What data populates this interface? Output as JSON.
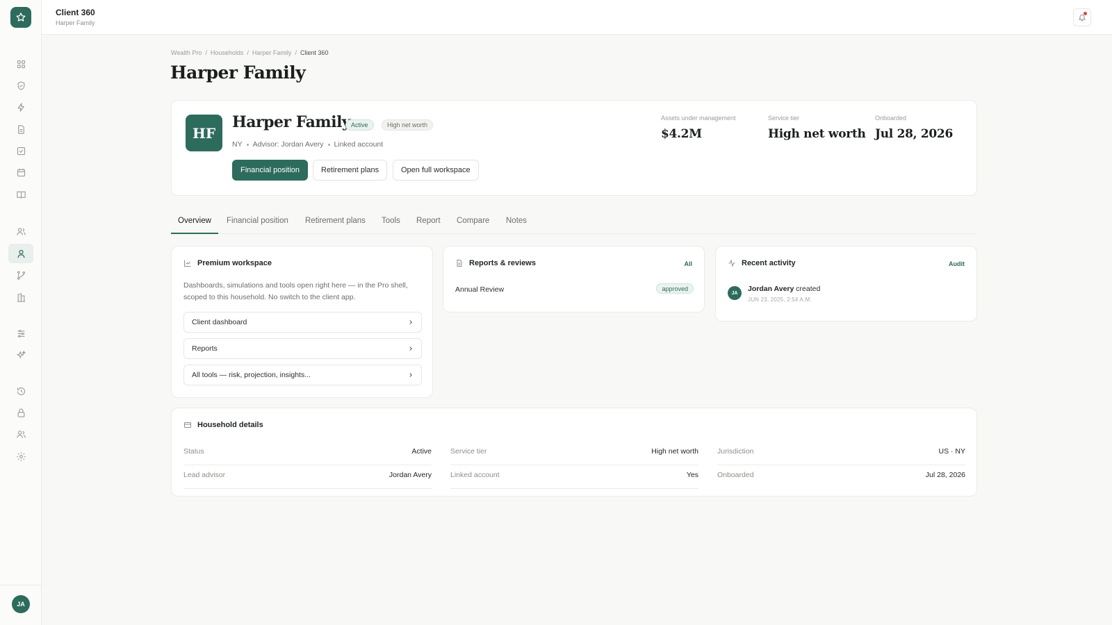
{
  "topbar": {
    "title": "Client 360",
    "subtitle": "Harper Family"
  },
  "breadcrumb": [
    "Wealth Pro",
    "Households",
    "Harper Family",
    "Client 360"
  ],
  "breadcrumb_sep": "/",
  "page": {
    "title": "Harper Family"
  },
  "client": {
    "initials": "HF",
    "name": "Harper Family",
    "status_badge": "Active",
    "tier_badge": "High net worth",
    "state": "NY",
    "advisor": "Advisor: Jordan Avery",
    "linked": "Linked account",
    "buttons": {
      "financial_position": "Financial position",
      "retirement_plans": "Retirement plans",
      "open_workspace": "Open full workspace"
    },
    "stats": [
      {
        "label": "Assets under management",
        "value": "$4.2M"
      },
      {
        "label": "Service tier",
        "value": "High net worth"
      },
      {
        "label": "Onboarded",
        "value": "Jul 28, 2026"
      }
    ]
  },
  "tabs": [
    "Overview",
    "Financial position",
    "Retirement plans",
    "Tools",
    "Report",
    "Compare",
    "Notes"
  ],
  "premium": {
    "title": "Premium workspace",
    "description": "Dashboards, simulations and tools open right here — in the Pro shell, scoped to this household. No switch to the client app.",
    "links": [
      "Client dashboard",
      "Reports",
      "All tools — risk, projection, insights..."
    ]
  },
  "reports": {
    "title": "Reports & reviews",
    "link": "All",
    "item": {
      "name": "Annual Review",
      "status": "approved"
    }
  },
  "activity": {
    "title": "Recent activity",
    "link": "Audit",
    "avatar": "JA",
    "actor": "Jordan Avery",
    "action": "created",
    "time": "JUN 23, 2025, 2:54 A.M."
  },
  "household": {
    "title": "Household details",
    "details": [
      {
        "key": "Status",
        "value": "Active"
      },
      {
        "key": "Service tier",
        "value": "High net worth"
      },
      {
        "key": "Jurisdiction",
        "value": "US · NY"
      },
      {
        "key": "Lead advisor",
        "value": "Jordan Avery"
      },
      {
        "key": "Linked account",
        "value": "Yes"
      },
      {
        "key": "Onboarded",
        "value": "Jul 28, 2026"
      }
    ]
  },
  "user": {
    "initials": "JA"
  },
  "colors": {
    "accent": "#2d6b5c",
    "background": "#f8f8f6",
    "notification": "#d9453a"
  },
  "nav_icons": [
    "dashboard-icon",
    "shield-icon",
    "lightning-icon",
    "document-icon",
    "checklist-icon",
    "calendar-icon",
    "book-icon",
    "users-icon",
    "user-icon",
    "branch-icon",
    "building-icon",
    "sliders-icon",
    "sparkles-icon",
    "history-icon",
    "lock-icon",
    "team-icon",
    "settings-icon"
  ]
}
